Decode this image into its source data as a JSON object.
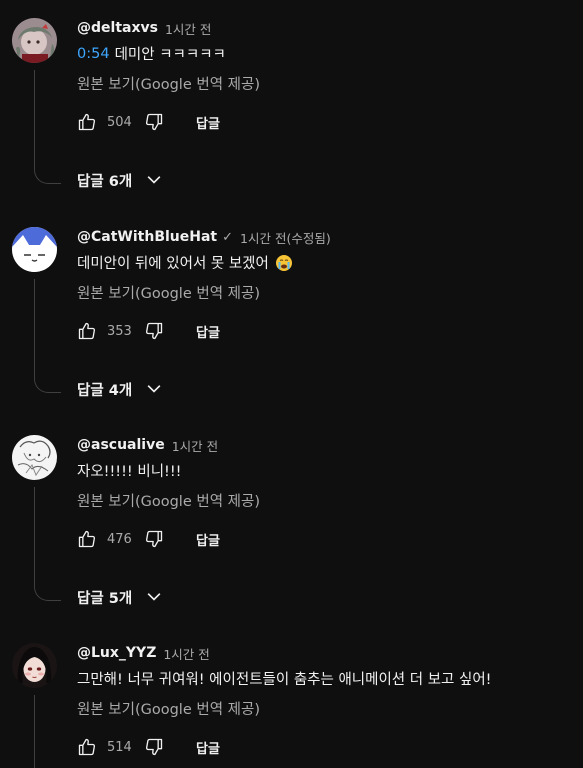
{
  "comments": [
    {
      "author": "@deltaxvs",
      "verified": false,
      "time": "1시간 전",
      "timestamp_link": "0:54",
      "text": "데미안 ㅋㅋㅋㅋㅋ",
      "emoji": "",
      "translate_label": "원본 보기(Google 번역 제공)",
      "like_count": "504",
      "reply_label": "답글",
      "replies_label": "답글 6개",
      "avatar_icon": "anime-girl-avatar"
    },
    {
      "author": "@CatWithBlueHat",
      "verified": true,
      "time": "1시간 전(수정됨)",
      "timestamp_link": "",
      "text": "데미안이 뒤에 있어서 못 보겠어",
      "emoji": "loudly-crying-face-emoji",
      "translate_label": "원본 보기(Google 번역 제공)",
      "like_count": "353",
      "reply_label": "답글",
      "replies_label": "답글 4개",
      "avatar_icon": "cat-blue-hat-avatar"
    },
    {
      "author": "@ascualive",
      "verified": false,
      "time": "1시간 전",
      "timestamp_link": "",
      "text": "자오!!!!! 비니!!!",
      "emoji": "",
      "translate_label": "원본 보기(Google 번역 제공)",
      "like_count": "476",
      "reply_label": "답글",
      "replies_label": "답글 5개",
      "avatar_icon": "sketch-avatar"
    },
    {
      "author": "@Lux_YYZ",
      "verified": false,
      "time": "1시간 전",
      "timestamp_link": "",
      "text": "그만해! 너무 귀여워! 에이전트들이 춤추는 애니메이션 더 보고 싶어!",
      "emoji": "",
      "translate_label": "원본 보기(Google 번역 제공)",
      "like_count": "514",
      "reply_label": "답글",
      "replies_label": "",
      "avatar_icon": "dark-hair-girl-avatar"
    }
  ],
  "colors": {
    "background": "#0f0f0f",
    "text_primary": "#f1f1f1",
    "text_secondary": "#aaaaaa",
    "link": "#3ea6ff",
    "thread_line": "#3f3f3f"
  },
  "icons": {
    "like": "thumbs-up-icon",
    "dislike": "thumbs-down-icon",
    "expand": "chevron-down-icon",
    "verified": "checkmark-icon"
  }
}
